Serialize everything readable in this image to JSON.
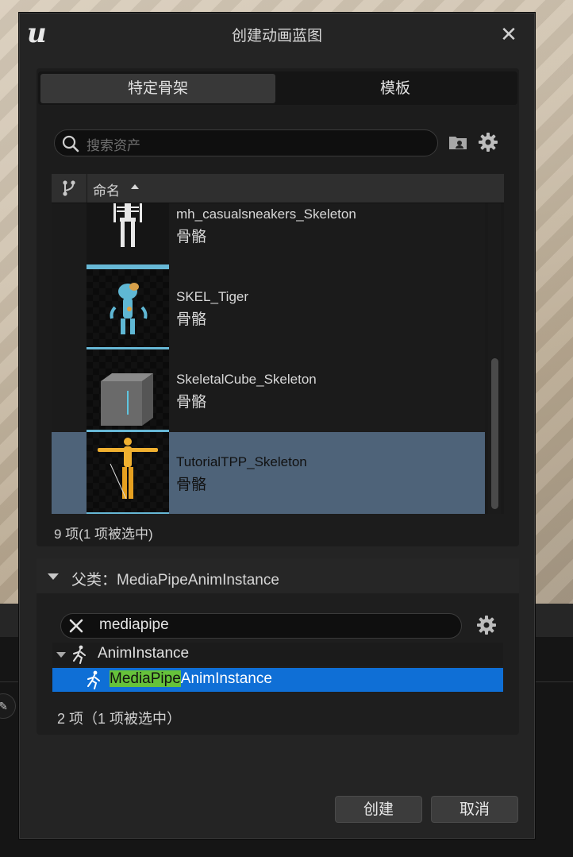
{
  "dialog": {
    "title": "创建动画蓝图",
    "logo_icon": "unreal-engine-logo",
    "close_icon": "close-icon"
  },
  "tabs": [
    {
      "label": "特定骨架",
      "active": true
    },
    {
      "label": "模板",
      "active": false
    }
  ],
  "search": {
    "placeholder": "搜索资产",
    "value": ""
  },
  "asset_list": {
    "column_header": "命名",
    "sort": "ascending",
    "items": [
      {
        "name": "mh_casualsneakers_Skeleton",
        "type": "骨骼",
        "selected": false,
        "thumbnail": "white-skeleton"
      },
      {
        "name": "SKEL_Tiger",
        "type": "骨骼",
        "selected": false,
        "thumbnail": "blue-tiger-skeleton"
      },
      {
        "name": "SkeletalCube_Skeleton",
        "type": "骨骼",
        "selected": false,
        "thumbnail": "grey-cube"
      },
      {
        "name": "TutorialTPP_Skeleton",
        "type": "骨骼",
        "selected": true,
        "thumbnail": "yellow-mannequin"
      }
    ],
    "count_text": "9 项(1 项被选中)"
  },
  "parent_class": {
    "label": "父类：MediaPipeAnimInstance",
    "filter_value": "mediapipe",
    "tree": [
      {
        "label": "AnimInstance",
        "level": 0,
        "selected": false
      },
      {
        "label_highlight": "MediaPipe",
        "label_rest": "AnimInstance",
        "level": 1,
        "selected": true
      }
    ],
    "count_text": "2 项（1 项被选中）"
  },
  "buttons": {
    "create": "创建",
    "cancel": "取消"
  },
  "colors": {
    "dialog_bg": "#242424",
    "selection_blue": "#0f6fd6",
    "selected_row": "#4e6379",
    "search_highlight": "#66c23a",
    "thumbnail_accent": "#67b8d6"
  }
}
